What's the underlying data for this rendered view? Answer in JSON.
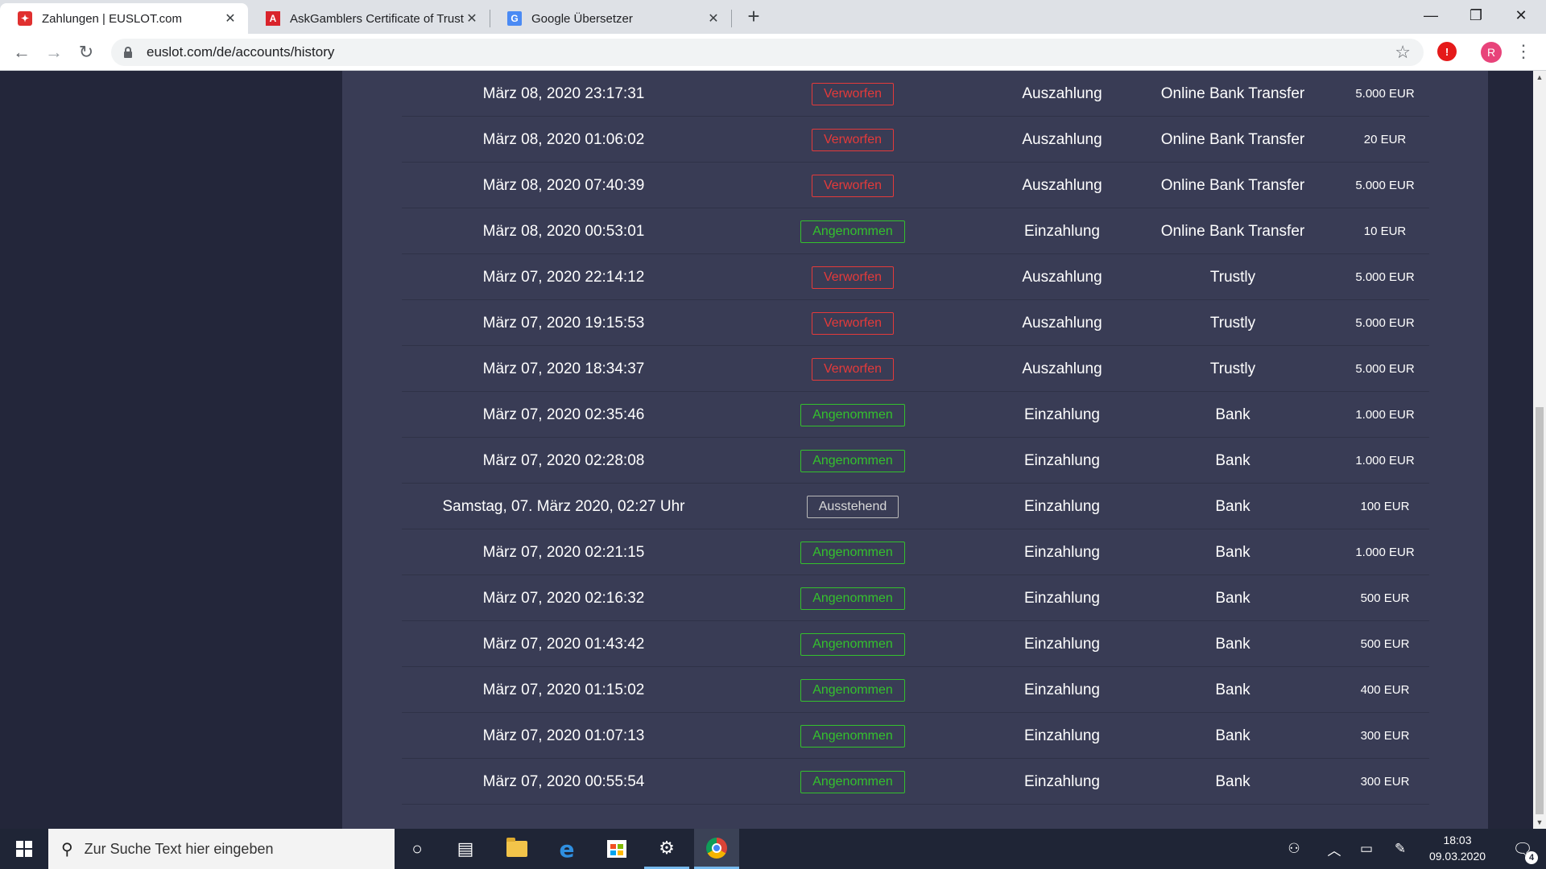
{
  "browser": {
    "tabs": [
      {
        "title": "Zahlungen | EUSLOT.com",
        "active": true,
        "favicon": "euslot-logo-icon"
      },
      {
        "title": "AskGamblers Certificate of Trust",
        "active": false,
        "favicon": "askgamblers-icon"
      },
      {
        "title": "Google Übersetzer",
        "active": false,
        "favicon": "google-translate-icon"
      }
    ],
    "url": "euslot.com/de/accounts/history",
    "extension_label": "!",
    "profile_initial": "R"
  },
  "history": {
    "rows": [
      {
        "date": "März 08, 2020 23:17:31",
        "status": "Verworfen",
        "status_kind": "rejected",
        "type": "Auszahlung",
        "method": "Online Bank Transfer",
        "amount": "5.000 EUR"
      },
      {
        "date": "März 08, 2020 01:06:02",
        "status": "Verworfen",
        "status_kind": "rejected",
        "type": "Auszahlung",
        "method": "Online Bank Transfer",
        "amount": "20 EUR"
      },
      {
        "date": "März 08, 2020 07:40:39",
        "status": "Verworfen",
        "status_kind": "rejected",
        "type": "Auszahlung",
        "method": "Online Bank Transfer",
        "amount": "5.000 EUR"
      },
      {
        "date": "März 08, 2020 00:53:01",
        "status": "Angenommen",
        "status_kind": "accepted",
        "type": "Einzahlung",
        "method": "Online Bank Transfer",
        "amount": "10 EUR"
      },
      {
        "date": "März 07, 2020 22:14:12",
        "status": "Verworfen",
        "status_kind": "rejected",
        "type": "Auszahlung",
        "method": "Trustly",
        "amount": "5.000 EUR"
      },
      {
        "date": "März 07, 2020 19:15:53",
        "status": "Verworfen",
        "status_kind": "rejected",
        "type": "Auszahlung",
        "method": "Trustly",
        "amount": "5.000 EUR"
      },
      {
        "date": "März 07, 2020 18:34:37",
        "status": "Verworfen",
        "status_kind": "rejected",
        "type": "Auszahlung",
        "method": "Trustly",
        "amount": "5.000 EUR"
      },
      {
        "date": "März 07, 2020 02:35:46",
        "status": "Angenommen",
        "status_kind": "accepted",
        "type": "Einzahlung",
        "method": "Bank",
        "amount": "1.000 EUR"
      },
      {
        "date": "März 07, 2020 02:28:08",
        "status": "Angenommen",
        "status_kind": "accepted",
        "type": "Einzahlung",
        "method": "Bank",
        "amount": "1.000 EUR"
      },
      {
        "date": "Samstag, 07. März 2020, 02:27 Uhr",
        "status": "Ausstehend",
        "status_kind": "pending",
        "type": "Einzahlung",
        "method": "Bank",
        "amount": "100 EUR"
      },
      {
        "date": "März 07, 2020 02:21:15",
        "status": "Angenommen",
        "status_kind": "accepted",
        "type": "Einzahlung",
        "method": "Bank",
        "amount": "1.000 EUR"
      },
      {
        "date": "März 07, 2020 02:16:32",
        "status": "Angenommen",
        "status_kind": "accepted",
        "type": "Einzahlung",
        "method": "Bank",
        "amount": "500 EUR"
      },
      {
        "date": "März 07, 2020 01:43:42",
        "status": "Angenommen",
        "status_kind": "accepted",
        "type": "Einzahlung",
        "method": "Bank",
        "amount": "500 EUR"
      },
      {
        "date": "März 07, 2020 01:15:02",
        "status": "Angenommen",
        "status_kind": "accepted",
        "type": "Einzahlung",
        "method": "Bank",
        "amount": "400 EUR"
      },
      {
        "date": "März 07, 2020 01:07:13",
        "status": "Angenommen",
        "status_kind": "accepted",
        "type": "Einzahlung",
        "method": "Bank",
        "amount": "300 EUR"
      },
      {
        "date": "März 07, 2020 00:55:54",
        "status": "Angenommen",
        "status_kind": "accepted",
        "type": "Einzahlung",
        "method": "Bank",
        "amount": "300 EUR"
      }
    ]
  },
  "colors": {
    "page_bg": "#23263a",
    "panel_bg": "#393c55",
    "rejected": "#e43a3a",
    "accepted": "#34c12d",
    "pending": "#b9b9b9"
  },
  "taskbar": {
    "search_placeholder": "Zur Suche Text hier eingeben",
    "time": "18:03",
    "date": "09.03.2020",
    "notification_count": "4"
  }
}
